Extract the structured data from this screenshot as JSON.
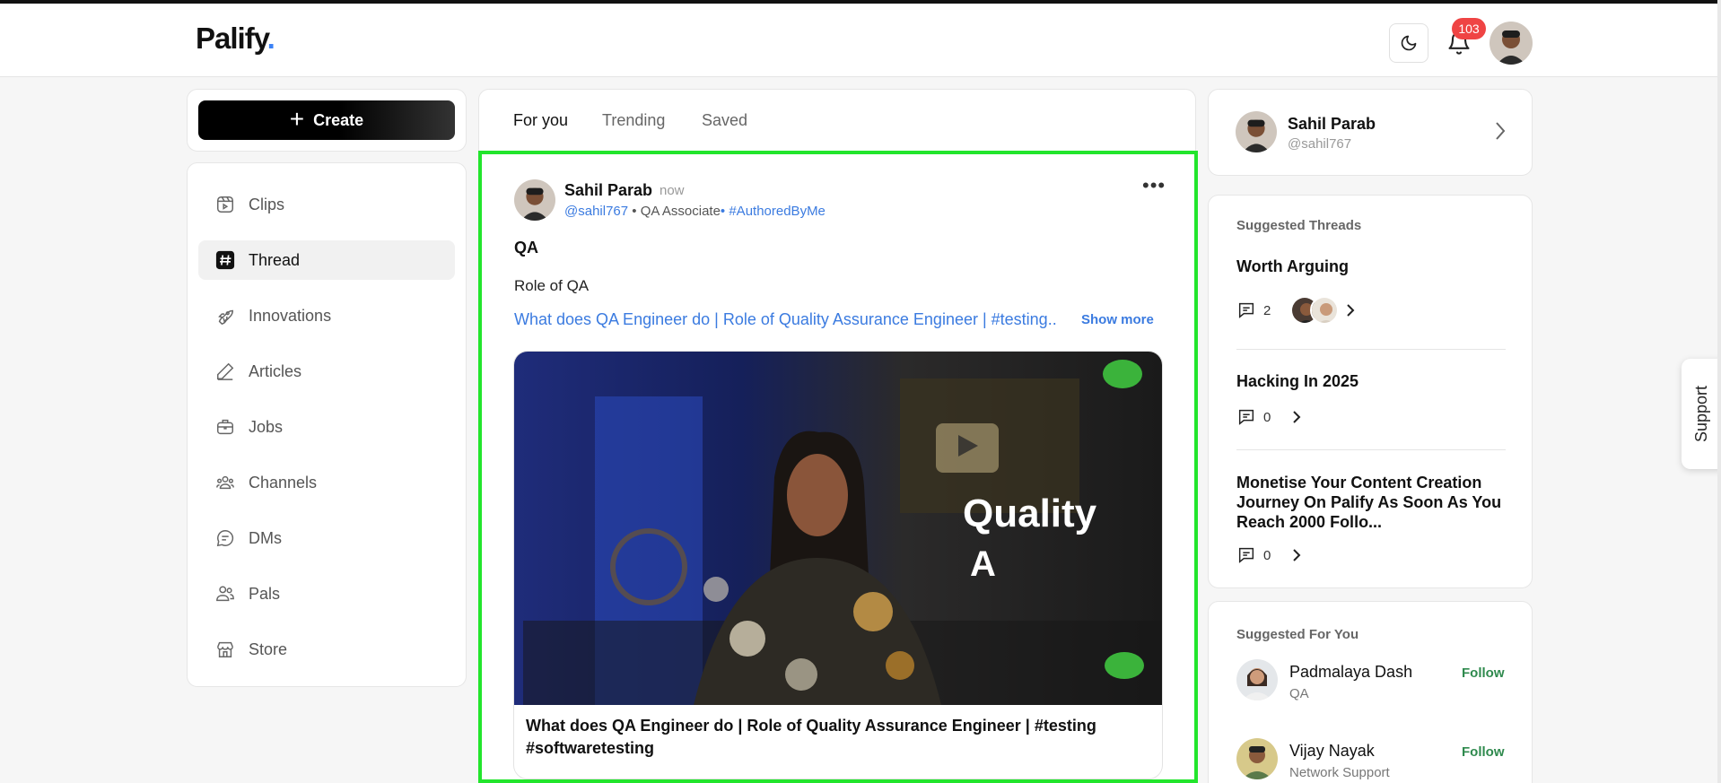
{
  "header": {
    "logo_text": "Palify",
    "logo_dot": ".",
    "notification_count": "103"
  },
  "sidebar": {
    "create_label": "Create",
    "items": [
      {
        "label": "Clips",
        "icon": "clips-icon"
      },
      {
        "label": "Thread",
        "icon": "hash-icon",
        "active": true
      },
      {
        "label": "Innovations",
        "icon": "rocket-icon"
      },
      {
        "label": "Articles",
        "icon": "pen-icon"
      },
      {
        "label": "Jobs",
        "icon": "briefcase-icon"
      },
      {
        "label": "Channels",
        "icon": "users-group-icon"
      },
      {
        "label": "DMs",
        "icon": "chat-icon"
      },
      {
        "label": "Pals",
        "icon": "people-icon"
      },
      {
        "label": "Store",
        "icon": "store-icon"
      }
    ]
  },
  "feed": {
    "tabs": [
      {
        "label": "For you",
        "active": true
      },
      {
        "label": "Trending"
      },
      {
        "label": "Saved"
      }
    ],
    "post": {
      "author": "Sahil Parab",
      "time": "now",
      "handle": "@sahil767",
      "role": "• QA Associate",
      "tag": "• #AuthoredByMe",
      "title": "QA",
      "body": "Role of QA",
      "link_text": "What does QA Engineer do | Role of Quality Assurance Engineer | #testing..",
      "show_more": "Show more",
      "video_overlay_line1": "Quality",
      "video_overlay_line2": "A",
      "video_caption": "What does QA Engineer do | Role of Quality Assurance Engineer | #testing #softwaretesting"
    }
  },
  "profile": {
    "name": "Sahil Parab",
    "handle": "@sahil767"
  },
  "suggested_threads": {
    "title": "Suggested Threads",
    "items": [
      {
        "title": "Worth Arguing",
        "comments": "2"
      },
      {
        "title": "Hacking In 2025",
        "comments": "0"
      },
      {
        "title": "Monetise Your Content Creation Journey On Palify As Soon As You Reach 2000 Follo...",
        "comments": "0"
      }
    ]
  },
  "suggested_for_you": {
    "title": "Suggested For You",
    "people": [
      {
        "name": "Padmalaya Dash",
        "role": "QA",
        "action": "Follow"
      },
      {
        "name": "Vijay Nayak",
        "role": "Network Support",
        "action": "Follow"
      }
    ]
  },
  "support_label": "Support",
  "colors": {
    "accent_blue": "#3b7be0",
    "highlight_green": "#22e52c",
    "badge_red": "#ef4444",
    "follow_green": "#2f8a4e"
  }
}
